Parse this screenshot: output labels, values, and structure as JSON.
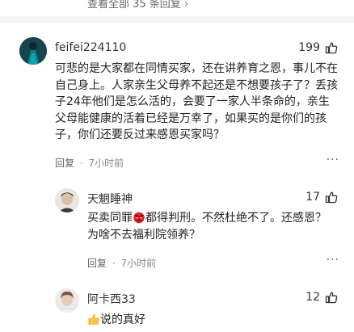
{
  "top": {
    "view_all_replies": "查看全部 35 条回复 ›"
  },
  "comments": [
    {
      "user": "feifei224110",
      "likes": "199",
      "lines": [
        "可悲的是大家都在同情买家，还在讲养育之恩，事儿不在",
        "自己身上。人家亲生父母养不起还是不想要孩子了？丢孩",
        "子24年他们是怎么活的，会要了一家人半条命的，亲生",
        "父母能健康的活着已经是万幸了，如果买的是你们的孩",
        "子，你们还要反过来感恩买家吗？"
      ],
      "reply": "回复",
      "sep": "·",
      "time": "7小时前",
      "more": "···"
    }
  ],
  "replies": [
    {
      "user": "天魍睡神",
      "likes": "17",
      "line1_before": "买卖同罪",
      "line1_after": "都得判刑。不然杜绝不了。还感恩？",
      "line2": "为啥不去福利院领养？",
      "reply": "回复",
      "sep": "·",
      "time": "7小时前",
      "more": "···"
    },
    {
      "user": "阿卡西33",
      "likes": "12",
      "text": "说的真好"
    }
  ],
  "colors": {
    "divider": "#f4f4f4",
    "meta": "#888888",
    "text": "#222222"
  },
  "icons": [
    "thumbs-up-icon",
    "angry-face-emoji",
    "thumbs-up-emoji",
    "more-icon"
  ]
}
